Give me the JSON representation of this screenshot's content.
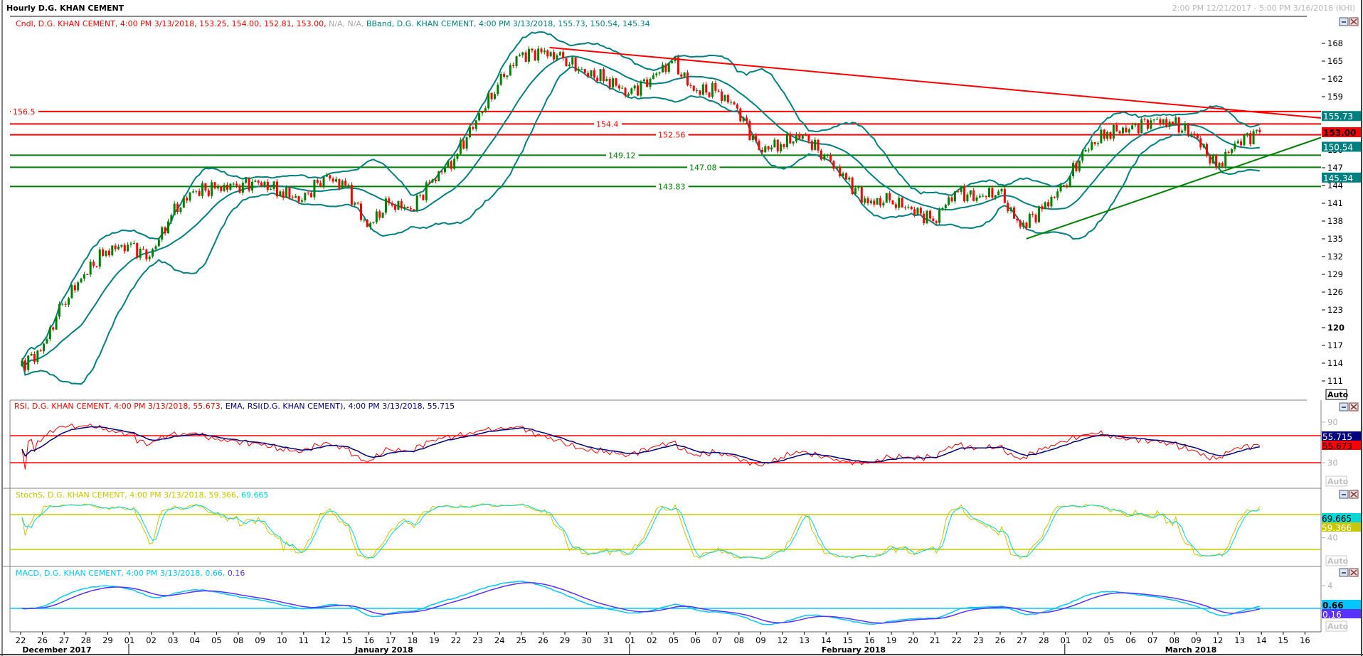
{
  "window": {
    "title": "Hourly D.G. KHAN CEMENT",
    "date_range": "2:00 PM 12/21/2017 - 5:00 PM 3/16/2018 (KHI)",
    "minimize_icon": "minimize-icon",
    "close_icon": "close-icon"
  },
  "main": {
    "legend_candle": "Cndl, D.G. KHAN CEMENT, 4:00 PM 3/13/2018, 153.25, 154.00, 152.81, 153.00, ",
    "legend_na": "N/A, N/A, ",
    "legend_bband": " BBand, D.G. KHAN CEMENT, 4:00 PM 3/13/2018, 155.73, 150.54, 145.34",
    "axis_ticks": [
      "168",
      "165",
      "162",
      "159",
      "156",
      "153",
      "150",
      "147",
      "144",
      "141",
      "138",
      "135",
      "132",
      "129",
      "126",
      "123",
      "120",
      "117",
      "114",
      "111"
    ],
    "auto_label": "Auto",
    "tags": [
      {
        "label": "155.73",
        "value": 155.73,
        "bg": "#008080",
        "fg": "#ffffff"
      },
      {
        "label": "153.00",
        "value": 153.0,
        "bg": "#ff0000",
        "fg": "#000000"
      },
      {
        "label": "150.54",
        "value": 150.54,
        "bg": "#008080",
        "fg": "#ffffff"
      },
      {
        "label": "145.34",
        "value": 145.34,
        "bg": "#008080",
        "fg": "#ffffff"
      }
    ]
  },
  "rsi": {
    "legend_rsi": "RSI, D.G. KHAN CEMENT, 4:00 PM 3/13/2018, 55.673, ",
    "legend_ema": " EMA, RSI(D.G. KHAN CEMENT), 4:00 PM 3/13/2018, 55.715",
    "axis_ticks": [
      "90",
      "30"
    ],
    "auto_label": "Auto",
    "tags": [
      {
        "label": "55.715",
        "bg": "#000080",
        "fg": "#ffffff"
      },
      {
        "label": "55.673",
        "bg": "#ff0000",
        "fg": "#000000"
      }
    ]
  },
  "stoch": {
    "legend_k": "StochS, D.G. KHAN CEMENT, 4:00 PM 3/13/2018, 59.366, ",
    "legend_d": "69.665",
    "axis_ticks": [
      "40"
    ],
    "auto_label": "Auto",
    "tags": [
      {
        "label": "69.665",
        "bg": "#00d8d8",
        "fg": "#000000"
      },
      {
        "label": "59.366",
        "bg": "#c8c800",
        "fg": "#ffffff"
      }
    ]
  },
  "macd": {
    "legend_macd": "MACD, D.G. KHAN CEMENT, 4:00 PM 3/13/2018, 0.66, ",
    "legend_signal": "0.16",
    "axis_ticks": [
      "4"
    ],
    "auto_label": "Auto",
    "tags": [
      {
        "label": "0.66",
        "bg": "#00c8ff",
        "fg": "#000000"
      },
      {
        "label": "0.16",
        "bg": "#5a32ff",
        "fg": "#ffffff"
      }
    ]
  },
  "x_axis": {
    "day_ticks": [
      "22",
      "26",
      "27",
      "28",
      "29",
      "01",
      "02",
      "03",
      "04",
      "05",
      "08",
      "09",
      "10",
      "11",
      "12",
      "15",
      "16",
      "17",
      "18",
      "19",
      "22",
      "23",
      "24",
      "25",
      "26",
      "29",
      "30",
      "31",
      "01",
      "02",
      "05",
      "06",
      "07",
      "08",
      "09",
      "12",
      "13",
      "14",
      "15",
      "16",
      "19",
      "20",
      "21",
      "22",
      "23",
      "26",
      "27",
      "28",
      "01",
      "02",
      "05",
      "06",
      "07",
      "08",
      "09",
      "12",
      "13",
      "14",
      "15",
      "16"
    ],
    "months": [
      "December 2017",
      "January 2018",
      "February 2018",
      "March 2018"
    ]
  },
  "colors": {
    "up": "#008000",
    "down": "#ff0000",
    "bband": "#008080",
    "resistance": "#ff0000",
    "support": "#008000",
    "rsi": "#ff0000",
    "rsi_ema": "#000080",
    "stoch_k": "#c8c800",
    "stoch_d": "#00d8d8",
    "macd": "#00c8ff",
    "signal": "#5a32ff"
  },
  "chart_data": {
    "type": "candlestick",
    "title": "Hourly D.G. KHAN CEMENT",
    "ylim": [
      109,
      170
    ],
    "daily_closes": [
      116,
      124,
      129,
      133,
      134,
      132,
      139,
      143,
      143.5,
      144,
      144.5,
      143,
      141.5,
      145.5,
      144,
      137,
      141,
      140,
      145,
      148.5,
      155,
      161,
      166,
      166.5,
      165.5,
      163,
      162,
      159.5,
      162,
      165,
      160,
      160,
      157,
      150,
      151,
      152.5,
      149,
      145,
      141,
      141.5,
      140,
      138,
      143,
      142,
      143,
      137,
      140,
      144,
      150,
      153,
      153.5,
      155,
      154.5,
      152.5,
      147,
      151.5,
      153
    ],
    "start_price": 113.5,
    "horizontal_levels": [
      {
        "label": "156.5",
        "value": 156.5,
        "kind": "resistance"
      },
      {
        "label": "154.4",
        "value": 154.4,
        "kind": "resistance"
      },
      {
        "label": "152.56",
        "value": 152.56,
        "kind": "resistance"
      },
      {
        "label": "149.12",
        "value": 149.12,
        "kind": "support"
      },
      {
        "label": "147.08",
        "value": 147.08,
        "kind": "support"
      },
      {
        "label": "143.83",
        "value": 143.83,
        "kind": "support"
      }
    ],
    "trendlines": [
      {
        "kind": "resistance",
        "from": [
          24.3,
          167.3
        ],
        "to": [
          60,
          155.4
        ]
      },
      {
        "kind": "support",
        "from": [
          46.2,
          135.0
        ],
        "to": [
          60,
          152.1
        ]
      }
    ],
    "rsi_levels": [
      70,
      30
    ],
    "stoch_levels": [
      80,
      20
    ],
    "macd_zero": 0
  }
}
